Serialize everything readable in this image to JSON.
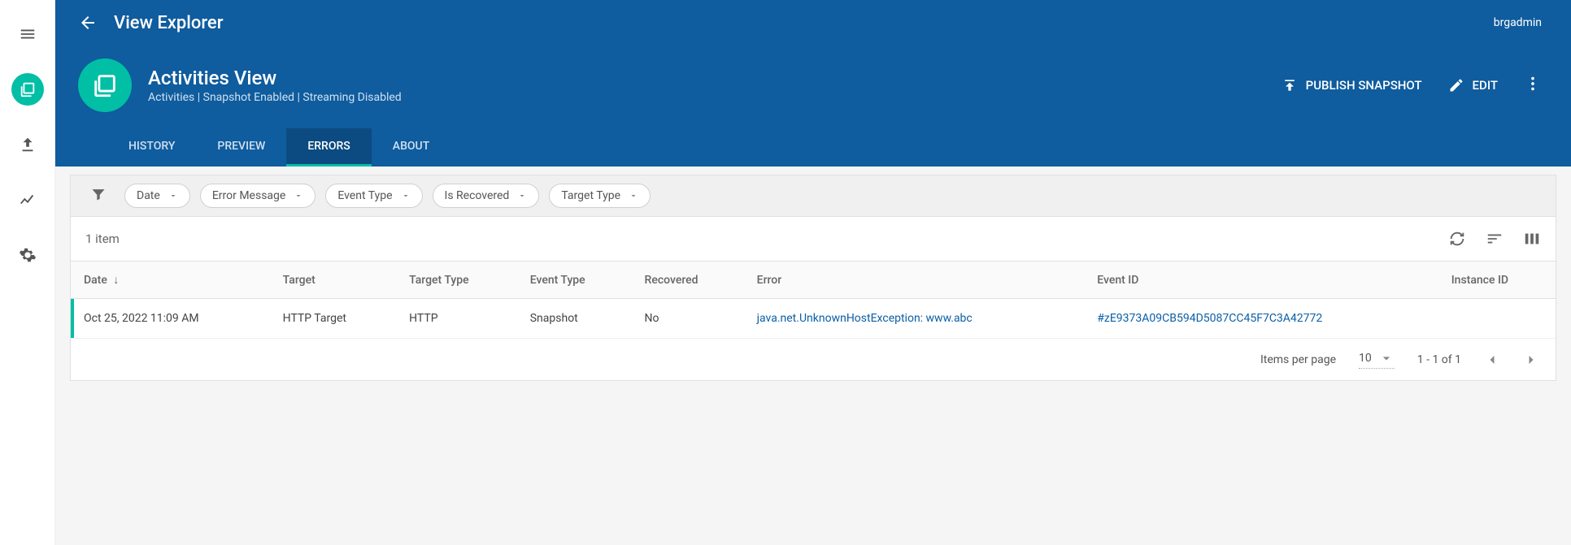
{
  "colors": {
    "primary": "#0f5c9e",
    "accent": "#00bfa5",
    "link": "#0b5fa5"
  },
  "rail": {
    "items": [
      {
        "name": "hamburger-icon"
      },
      {
        "name": "views-icon"
      },
      {
        "name": "upload-icon"
      },
      {
        "name": "chart-line-icon"
      },
      {
        "name": "gear-icon"
      }
    ]
  },
  "header": {
    "section_title": "View Explorer",
    "user": "brgadmin",
    "view_name": "Activities View",
    "view_meta": "Activities | Snapshot Enabled | Streaming Disabled",
    "btn_publish": "PUBLISH SNAPSHOT",
    "btn_edit": "EDIT",
    "tabs": [
      {
        "label": "HISTORY",
        "active": false
      },
      {
        "label": "PREVIEW",
        "active": false
      },
      {
        "label": "ERRORS",
        "active": true
      },
      {
        "label": "ABOUT",
        "active": false
      }
    ]
  },
  "filters": {
    "chips": [
      "Date",
      "Error Message",
      "Event Type",
      "Is Recovered",
      "Target Type"
    ]
  },
  "panel": {
    "item_count": "1 item",
    "columns": [
      "Date",
      "Target",
      "Target Type",
      "Event Type",
      "Recovered",
      "Error",
      "Event ID",
      "Instance ID"
    ],
    "sort_column": "Date",
    "sort_dir": "desc",
    "rows": [
      {
        "date": "Oct 25, 2022 11:09 AM",
        "target": "HTTP Target",
        "target_type": "HTTP",
        "event_type": "Snapshot",
        "recovered": "No",
        "error": "java.net.UnknownHostException: www.abc",
        "event_id": "#zE9373A09CB594D5087CC45F7C3A42772",
        "instance_id": ""
      }
    ]
  },
  "pager": {
    "items_per_page_label": "Items per page",
    "page_size": "10",
    "range": "1 - 1 of 1"
  }
}
